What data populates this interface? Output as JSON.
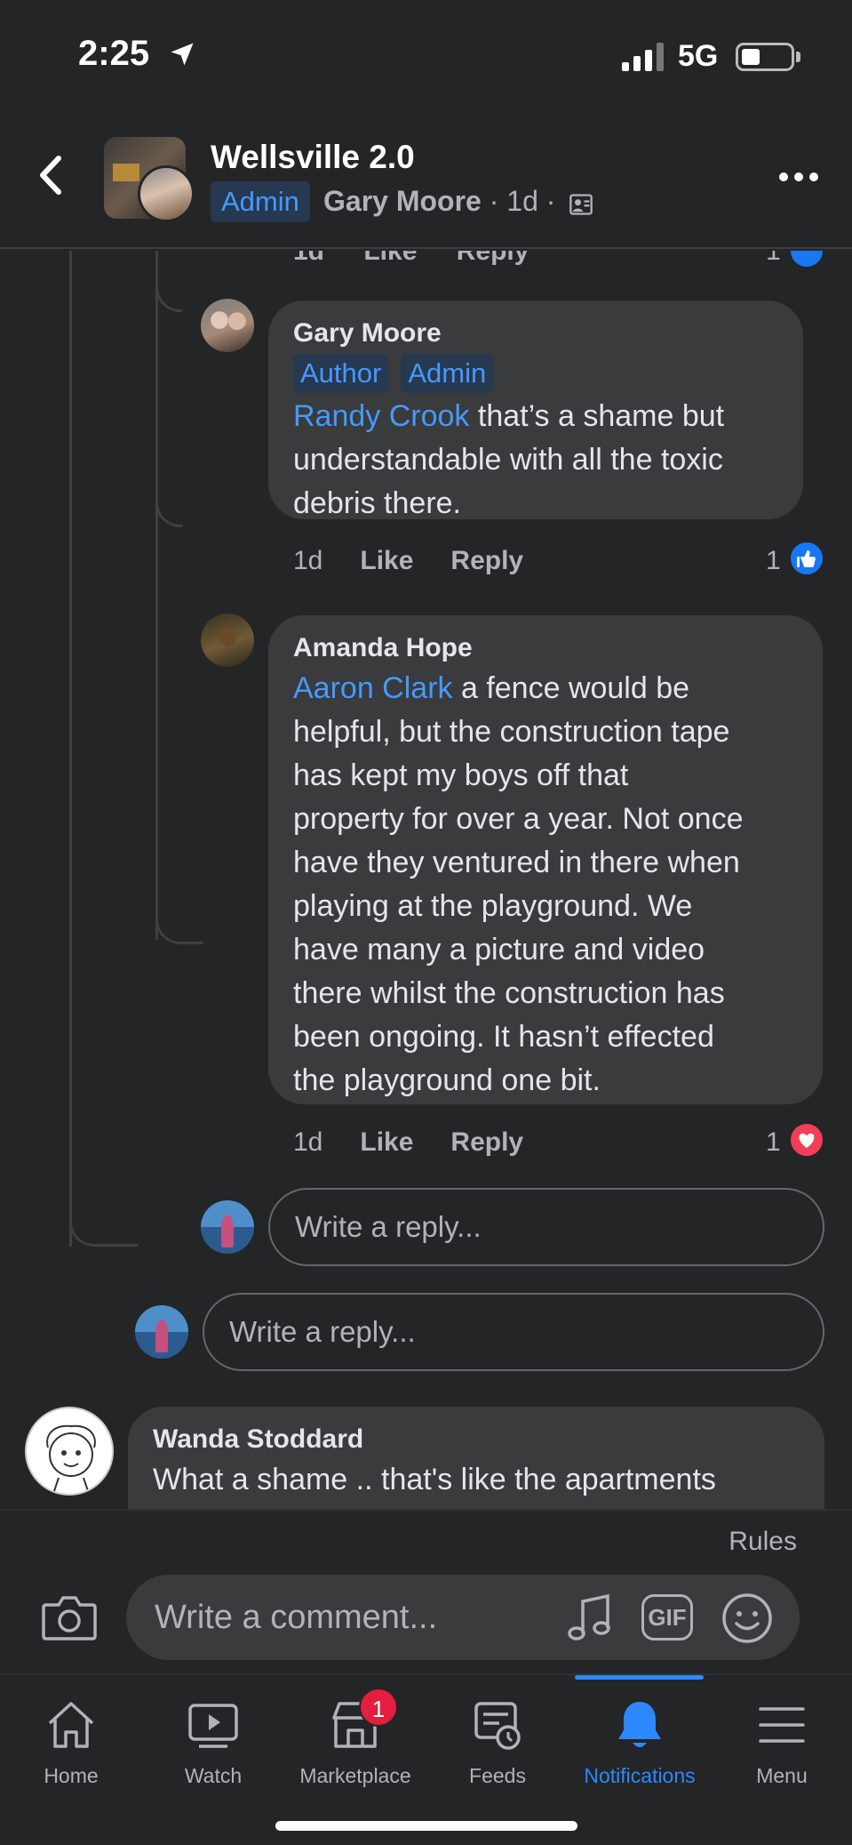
{
  "status_bar": {
    "time": "2:25",
    "network": "5G"
  },
  "header": {
    "group_name": "Wellsville 2.0",
    "admin_badge": "Admin",
    "author": "Gary Moore",
    "age": "1d",
    "separator": "·"
  },
  "previous_comment": {
    "time": "1d",
    "like": "Like",
    "reply": "Reply",
    "reaction_count": "1"
  },
  "comments": [
    {
      "name": "Gary Moore",
      "badges": [
        "Author",
        "Admin"
      ],
      "mention": "Randy Crook",
      "text_lines": [
        " that’s a shame but",
        "understandable with all the toxic",
        "debris there."
      ],
      "time": "1d",
      "like": "Like",
      "reply": "Reply",
      "reaction_count": "1",
      "reaction": "like"
    },
    {
      "name": "Amanda Hope",
      "mention": "Aaron Clark",
      "text_lines": [
        " a fence would be",
        "helpful, but the construction tape",
        "has kept my boys off that",
        "property for over a year. Not once",
        "have they ventured in there when",
        "playing at the playground. We",
        "have many a picture and video",
        "there whilst the construction has",
        "been ongoing. It hasn’t effected",
        "the playground one bit."
      ],
      "time": "1d",
      "like": "Like",
      "reply": "Reply",
      "reaction_count": "1",
      "reaction": "love"
    }
  ],
  "reply_placeholder": "Write a reply...",
  "next_comment": {
    "name": "Wanda Stoddard",
    "text": "What a shame ..  that's like the apartments"
  },
  "composer": {
    "rules": "Rules",
    "placeholder": "Write a comment...",
    "gif": "GIF"
  },
  "tabs": [
    {
      "label": "Home",
      "icon": "home-icon"
    },
    {
      "label": "Watch",
      "icon": "watch-icon"
    },
    {
      "label": "Marketplace",
      "icon": "marketplace-icon",
      "badge": "1"
    },
    {
      "label": "Feeds",
      "icon": "feeds-icon"
    },
    {
      "label": "Notifications",
      "icon": "bell-icon",
      "active": true
    },
    {
      "label": "Menu",
      "icon": "menu-icon"
    }
  ],
  "colors": {
    "accent": "#2d88ff",
    "mention": "#4599ff",
    "bubble": "#3a3b3c",
    "background": "#242526",
    "love": "#f33e58",
    "like": "#1877f2"
  }
}
